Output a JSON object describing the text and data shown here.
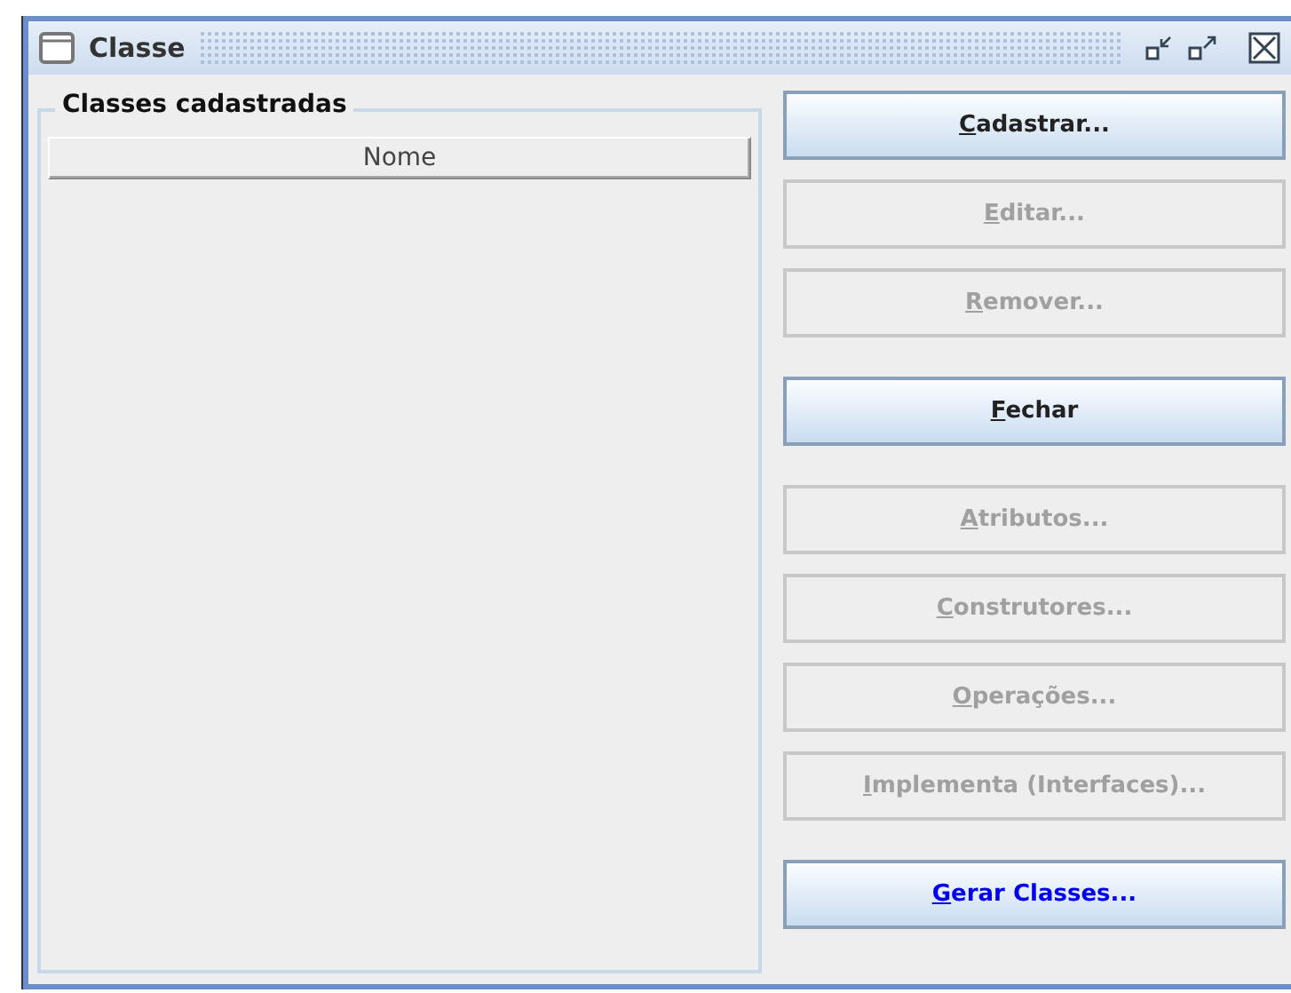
{
  "window": {
    "title": "Classe"
  },
  "group": {
    "title": "Classes cadastradas",
    "table": {
      "columns": [
        "Nome"
      ]
    }
  },
  "buttons": [
    {
      "label": "Cadastrar...",
      "disabled": false,
      "default": false
    },
    {
      "label": "Editar...",
      "disabled": true,
      "default": false
    },
    {
      "label": "Remover...",
      "disabled": true,
      "default": false
    },
    {
      "label": "Fechar",
      "disabled": false,
      "default": false,
      "gap_before": true
    },
    {
      "label": "Atributos...",
      "disabled": true,
      "default": false,
      "gap_before": true
    },
    {
      "label": "Construtores...",
      "disabled": true,
      "default": false
    },
    {
      "label": "Operações...",
      "disabled": true,
      "default": false
    },
    {
      "label": "Implementa (Interfaces)...",
      "disabled": true,
      "default": false
    },
    {
      "label": "Gerar Classes...",
      "disabled": false,
      "default": true,
      "gap_before": true
    }
  ]
}
